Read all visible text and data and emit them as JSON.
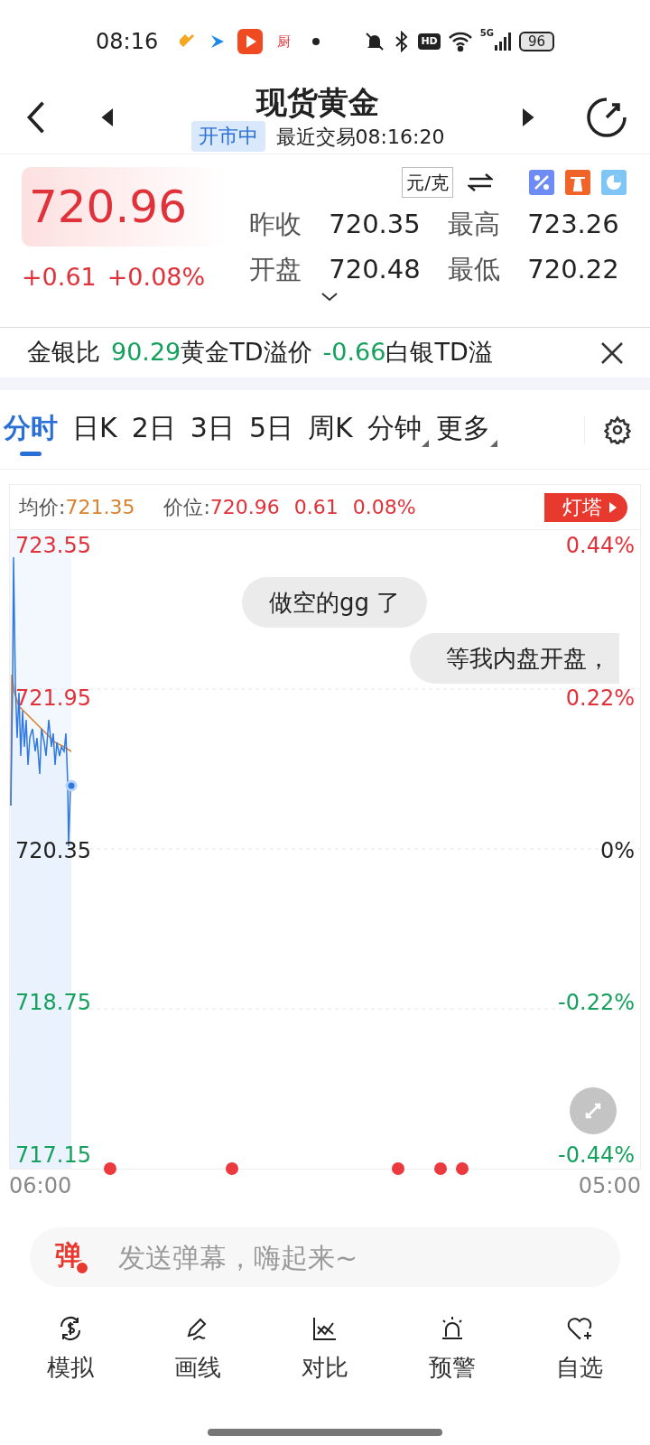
{
  "status_bar": {
    "time": "08:16",
    "app_badge": "厨",
    "hd": "HD",
    "network": "5G",
    "battery": "96"
  },
  "header": {
    "title": "现货黄金",
    "market_state": "开市中",
    "last_trade": "最近交易08:16:20"
  },
  "quote": {
    "price": "720.96",
    "change": "+0.61",
    "change_pct": "+0.08%",
    "unit": "元/克",
    "stats": [
      {
        "label": "昨收",
        "value": "720.35"
      },
      {
        "label": "最高",
        "value": "723.26"
      },
      {
        "label": "开盘",
        "value": "720.48"
      },
      {
        "label": "最低",
        "value": "720.22"
      }
    ]
  },
  "ticker": [
    {
      "label": "金银比",
      "value": "90.29"
    },
    {
      "label": "黄金TD溢价",
      "value": "-0.66"
    },
    {
      "label": "白银TD溢"
    }
  ],
  "tabs": [
    {
      "label": "分时",
      "selected": true,
      "dropdown": false
    },
    {
      "label": "日K",
      "selected": false,
      "dropdown": false
    },
    {
      "label": "2日",
      "selected": false,
      "dropdown": false
    },
    {
      "label": "3日",
      "selected": false,
      "dropdown": false
    },
    {
      "label": "5日",
      "selected": false,
      "dropdown": false
    },
    {
      "label": "周K",
      "selected": false,
      "dropdown": false
    },
    {
      "label": "分钟",
      "selected": false,
      "dropdown": true
    },
    {
      "label": "更多",
      "selected": false,
      "dropdown": true
    }
  ],
  "chart": {
    "avg_label": "均价:",
    "avg_value": "721.35",
    "price_label": "价位:",
    "price_value": "720.96",
    "change": "0.61",
    "change_pct": "0.08%",
    "badge": "灯塔",
    "y_labels": [
      {
        "price": "723.55",
        "pct": "0.44%",
        "color": "#e0323a"
      },
      {
        "price": "721.95",
        "pct": "0.22%",
        "color": "#e0323a"
      },
      {
        "price": "720.35",
        "pct": "0%",
        "color": "#222222"
      },
      {
        "price": "718.75",
        "pct": "-0.22%",
        "color": "#16a05d"
      },
      {
        "price": "717.15",
        "pct": "-0.44%",
        "color": "#16a05d"
      }
    ],
    "x_start": "06:00",
    "x_end": "05:00",
    "comments": [
      "做空的gg 了",
      "等我内盘开盘，"
    ]
  },
  "danmaku": {
    "icon": "弹",
    "placeholder": "发送弹幕，嗨起来~"
  },
  "bottom_nav": [
    {
      "label": "模拟"
    },
    {
      "label": "画线"
    },
    {
      "label": "对比"
    },
    {
      "label": "预警"
    },
    {
      "label": "自选"
    }
  ]
}
